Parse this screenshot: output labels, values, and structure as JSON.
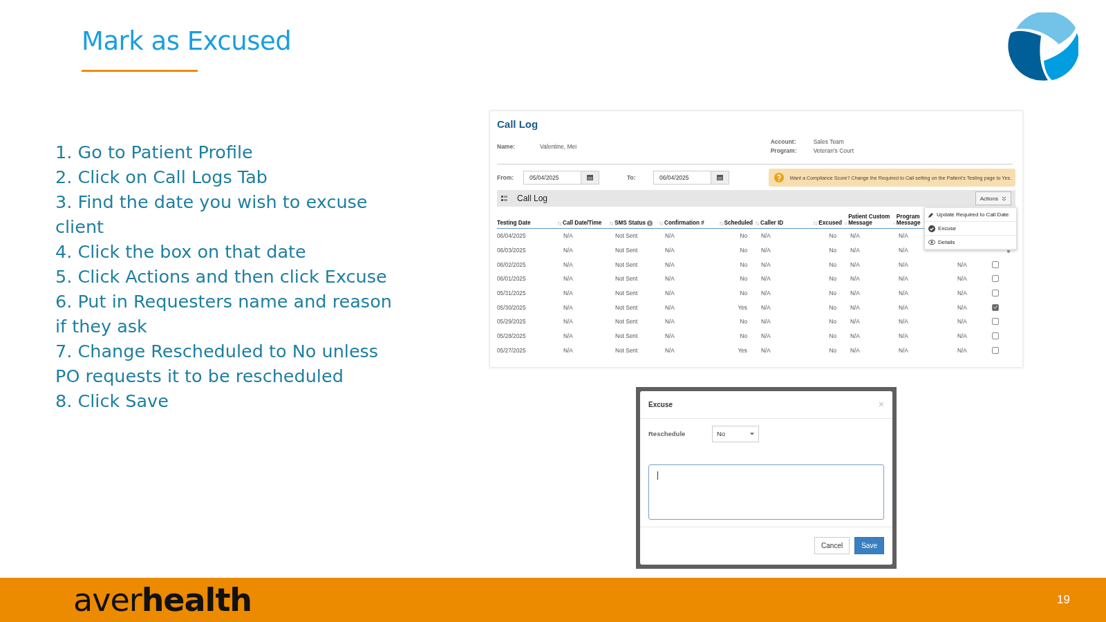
{
  "slide": {
    "title": "Mark as Excused",
    "page_number": "19",
    "brand": {
      "light": "aver",
      "bold": "health"
    }
  },
  "steps": [
    "1. Go to Patient Profile",
    "2. Click on Call Logs Tab",
    "3. Find the date you wish to excuse client",
    "4. Click the box on that date",
    "5. Click Actions and then click Excuse",
    "6. Put in Requesters name and reason if they ask",
    "7. Change Rescheduled to No unless PO requests it to be rescheduled",
    "8. Click Save"
  ],
  "call_log": {
    "title": "Call Log",
    "info": [
      {
        "label": "Name:",
        "value": "Valentine, Mei"
      },
      {
        "label": "Account:",
        "value": "Sales Team"
      },
      {
        "label": "Program:",
        "value": "Veteran's Court"
      }
    ],
    "from": {
      "label": "From:",
      "value": "05/04/2025"
    },
    "to": {
      "label": "To:",
      "value": "06/04/2025"
    },
    "notice": "Want a Compliance Score? Change the Required to Call setting on the Patient's Testing page to Yes.",
    "grid_title": "Call Log",
    "actions_button": "Actions",
    "actions_menu": [
      "Update Required to Call Date",
      "Excuse",
      "Details"
    ],
    "columns": [
      "Testing Date",
      "Call Date/Time",
      "SMS Status",
      "Confirmation #",
      "Scheduled",
      "Caller ID",
      "Excused",
      "Patient Custom Message",
      "Program Message"
    ],
    "rows": [
      {
        "cells": [
          "06/04/2025",
          "N/A",
          "Not Sent",
          "N/A",
          "No",
          "N/A",
          "No",
          "N/A",
          "N/A"
        ]
      },
      {
        "cells": [
          "06/03/2025",
          "N/A",
          "Not Sent",
          "N/A",
          "No",
          "N/A",
          "No",
          "N/A",
          "N/A"
        ]
      },
      {
        "cells": [
          "06/02/2025",
          "N/A",
          "Not Sent",
          "N/A",
          "No",
          "N/A",
          "No",
          "N/A",
          "N/A"
        ],
        "column_10": "N/A",
        "checked": false
      },
      {
        "cells": [
          "06/01/2025",
          "N/A",
          "Not Sent",
          "N/A",
          "No",
          "N/A",
          "No",
          "N/A",
          "N/A"
        ],
        "column_10": "N/A",
        "checked": false
      },
      {
        "cells": [
          "05/31/2025",
          "N/A",
          "Not Sent",
          "N/A",
          "No",
          "N/A",
          "No",
          "N/A",
          "N/A"
        ],
        "column_10": "N/A",
        "checked": false
      },
      {
        "cells": [
          "05/30/2025",
          "N/A",
          "Not Sent",
          "N/A",
          "Yes",
          "N/A",
          "No",
          "N/A",
          "N/A"
        ],
        "column_10": "N/A",
        "checked": true
      },
      {
        "cells": [
          "05/29/2025",
          "N/A",
          "Not Sent",
          "N/A",
          "No",
          "N/A",
          "No",
          "N/A",
          "N/A"
        ],
        "column_10": "N/A",
        "checked": false
      },
      {
        "cells": [
          "05/28/2025",
          "N/A",
          "Not Sent",
          "N/A",
          "No",
          "N/A",
          "No",
          "N/A",
          "N/A"
        ],
        "column_10": "N/A",
        "checked": false
      },
      {
        "cells": [
          "05/27/2025",
          "N/A",
          "Not Sent",
          "N/A",
          "Yes",
          "N/A",
          "No",
          "N/A",
          "N/A"
        ],
        "column_10": "N/A",
        "checked": false
      }
    ]
  },
  "excuse_dialog": {
    "title": "Excuse",
    "close": "×",
    "reschedule_label": "Reschedule",
    "reschedule_value": "No",
    "buttons": [
      {
        "label": "Cancel",
        "kind": "secondary"
      },
      {
        "label": "Save",
        "kind": "primary"
      }
    ]
  }
}
